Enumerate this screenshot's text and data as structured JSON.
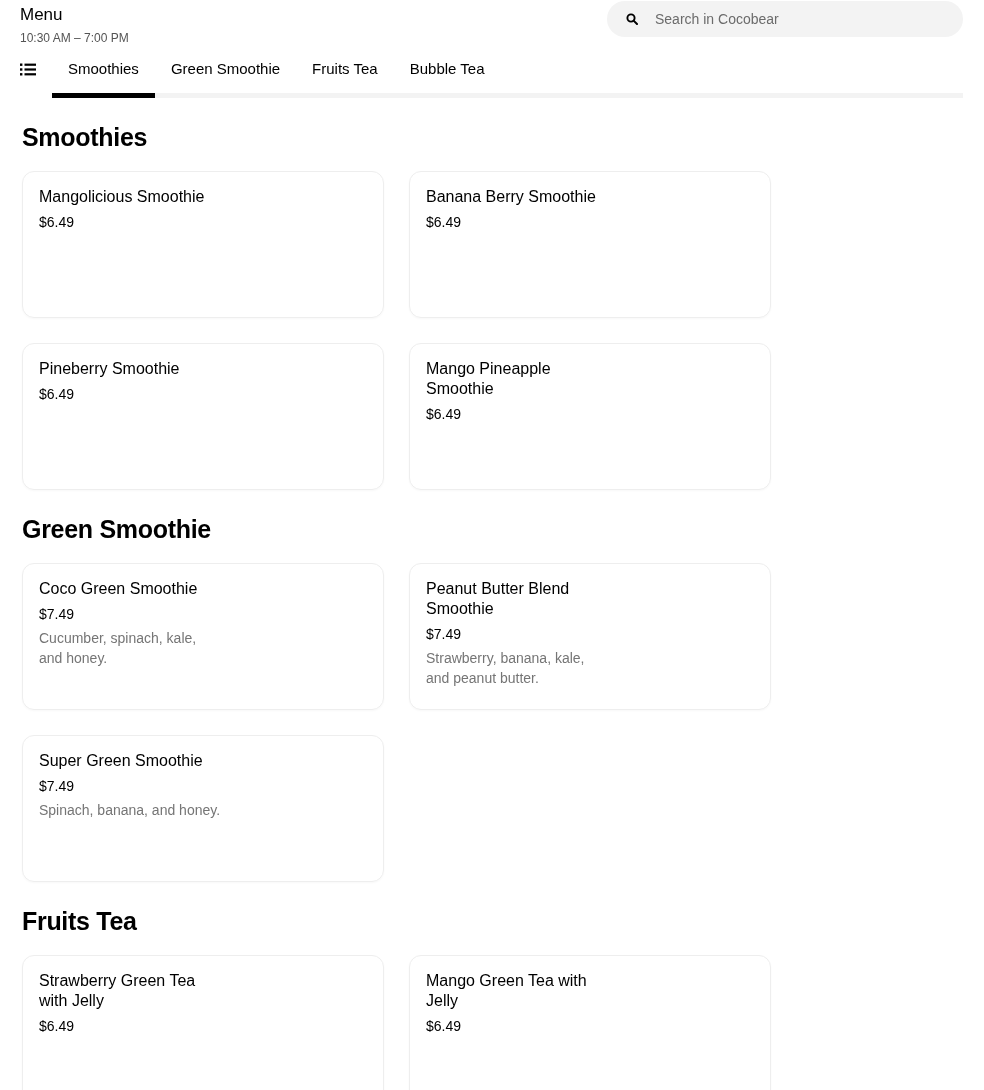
{
  "header": {
    "title": "Menu",
    "hours": "10:30 AM – 7:00 PM"
  },
  "search": {
    "placeholder": "Search in Cocobear"
  },
  "tabs": [
    {
      "label": "Smoothies",
      "selected": true
    },
    {
      "label": "Green Smoothie",
      "selected": false
    },
    {
      "label": "Fruits Tea",
      "selected": false
    },
    {
      "label": "Bubble Tea",
      "selected": false
    }
  ],
  "sections": [
    {
      "title": "Smoothies",
      "items": [
        {
          "name": "Mangolicious Smoothie",
          "price": "$6.49"
        },
        {
          "name": "Banana Berry Smoothie",
          "price": "$6.49"
        },
        {
          "name": "Pineberry Smoothie",
          "price": "$6.49"
        },
        {
          "name": "Mango Pineapple Smoothie",
          "price": "$6.49"
        }
      ]
    },
    {
      "title": "Green Smoothie",
      "items": [
        {
          "name": "Coco Green Smoothie",
          "price": "$7.49",
          "description": "Cucumber, spinach, kale, and honey."
        },
        {
          "name": "Peanut Butter Blend Smoothie",
          "price": "$7.49",
          "description": "Strawberry, banana, kale, and peanut butter."
        },
        {
          "name": "Super Green Smoothie",
          "price": "$7.49",
          "description": "Spinach, banana, and honey."
        }
      ]
    },
    {
      "title": "Fruits Tea",
      "items": [
        {
          "name": "Strawberry Green Tea with Jelly",
          "price": "$6.49"
        },
        {
          "name": "Mango Green Tea with Jelly",
          "price": "$6.49"
        }
      ]
    }
  ]
}
